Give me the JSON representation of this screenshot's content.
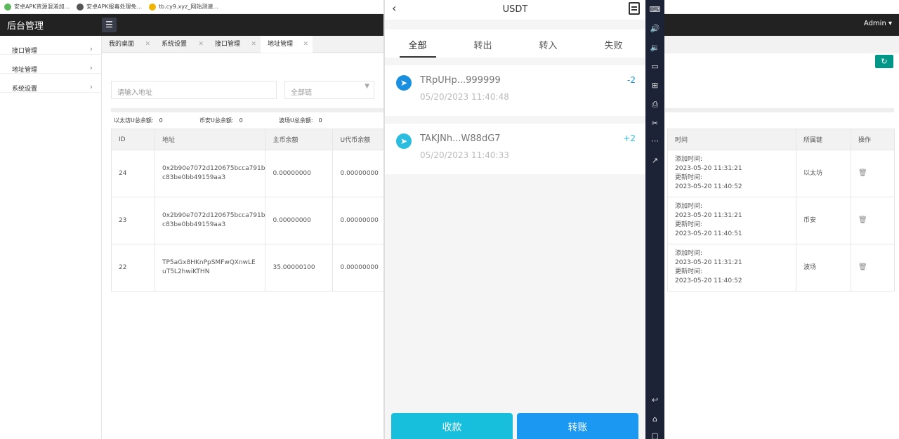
{
  "bookmarks": [
    "安卓APK资源混淆加...",
    "安卓APK报毒处理免...",
    "tb.cy9.xyz_网站测速..."
  ],
  "header": {
    "logo": "后台管理",
    "menu_toggle": "☰",
    "admin": "Admin ▾"
  },
  "sidebar": {
    "items": [
      {
        "label": "接口管理"
      },
      {
        "label": "地址管理"
      },
      {
        "label": "系统设置"
      }
    ]
  },
  "tabs": [
    {
      "label": "我的桌面"
    },
    {
      "label": "系统设置"
    },
    {
      "label": "接口管理"
    },
    {
      "label": "地址管理"
    }
  ],
  "filters": {
    "address_placeholder": "请输入地址",
    "chain_select": "全部链"
  },
  "totals": [
    {
      "label": "以太坊U总余额:",
      "value": "0"
    },
    {
      "label": "币安U总余额:",
      "value": "0"
    },
    {
      "label": "波场U总余额:",
      "value": "0"
    }
  ],
  "table": {
    "headers": {
      "id": "ID",
      "address": "地址",
      "main_balance": "主币余额",
      "u_balance": "U代币余额",
      "time": "时间",
      "chain": "所属链",
      "action": "操作"
    },
    "rows": [
      {
        "id": "24",
        "address_line1": "0x2b90e7072d120675bcca791b",
        "address_line2": "c83be0bb49159aa3",
        "main_balance": "0.00000000",
        "u_balance": "0.00000000",
        "added_label": "添加时间:",
        "added": "2023-05-20 11:31:21",
        "updated_label": "更新时间:",
        "updated": "2023-05-20 11:40:52",
        "chain": "以太坊"
      },
      {
        "id": "23",
        "address_line1": "0x2b90e7072d120675bcca791b",
        "address_line2": "c83be0bb49159aa3",
        "main_balance": "0.00000000",
        "u_balance": "0.00000000",
        "added_label": "添加时间:",
        "added": "2023-05-20 11:31:21",
        "updated_label": "更新时间:",
        "updated": "2023-05-20 11:40:51",
        "chain": "币安"
      },
      {
        "id": "22",
        "address_line1": "TP5aGx8HKnPpSMFwQXnwLE",
        "address_line2": "uT5L2hwiKTHN",
        "main_balance": "35.00000100",
        "u_balance": "0.00000000",
        "added_label": "添加时间:",
        "added": "2023-05-20 11:31:21",
        "updated_label": "更新时间:",
        "updated": "2023-05-20 11:40:52",
        "chain": "波场"
      }
    ]
  },
  "phone": {
    "title": "USDT",
    "tabs": [
      "全部",
      "转出",
      "转入",
      "失败"
    ],
    "transactions": [
      {
        "address": "TRpUHp...999999",
        "time": "05/20/2023 11:40:48",
        "amount": "-2",
        "color": "#1a8fe0"
      },
      {
        "address": "TAKJNh...W88dG7",
        "time": "05/20/2023 11:40:33",
        "amount": "+2",
        "color": "#2bbde0"
      }
    ],
    "receive": "收款",
    "transfer": "转账"
  },
  "colors": {
    "accent": "#009688",
    "receive_btn": "#17bfdc",
    "transfer_btn": "#1a98f2",
    "amount_out": "#1a8fe0",
    "amount_in": "#2bbde0"
  }
}
